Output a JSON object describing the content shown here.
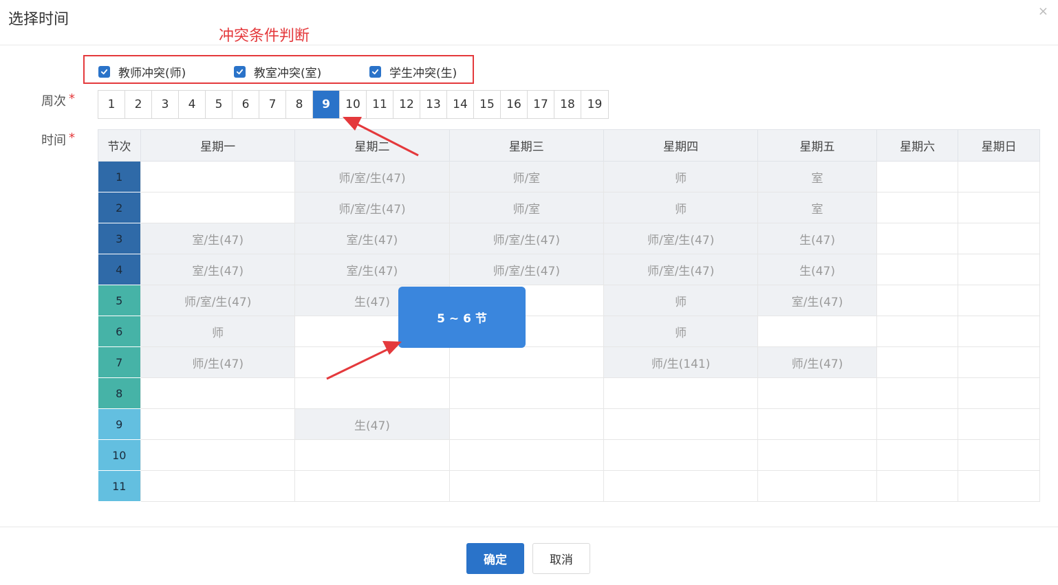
{
  "dialog": {
    "title": "选择时间",
    "close_symbol": "×"
  },
  "annotation": {
    "title": "冲突条件判断",
    "color": "#e4393c"
  },
  "conflicts": [
    {
      "label": "教师冲突(师)",
      "checked": true
    },
    {
      "label": "教室冲突(室)",
      "checked": true
    },
    {
      "label": "学生冲突(生)",
      "checked": true
    }
  ],
  "form": {
    "week_label": "周次",
    "time_label": "时间",
    "required_mark": "*"
  },
  "weeks": {
    "items": [
      "1",
      "2",
      "3",
      "4",
      "5",
      "6",
      "7",
      "8",
      "9",
      "10",
      "11",
      "12",
      "13",
      "14",
      "15",
      "16",
      "17",
      "18",
      "19"
    ],
    "selected": "9"
  },
  "timetable": {
    "period_header": "节次",
    "days": [
      "星期一",
      "星期二",
      "星期三",
      "星期四",
      "星期五",
      "星期六",
      "星期日"
    ],
    "periods": [
      {
        "label": "1",
        "color": "#2f6aa8"
      },
      {
        "label": "2",
        "color": "#2f6aa8"
      },
      {
        "label": "3",
        "color": "#2f6aa8"
      },
      {
        "label": "4",
        "color": "#2f6aa8"
      },
      {
        "label": "5",
        "color": "#46b3a7"
      },
      {
        "label": "6",
        "color": "#46b3a7"
      },
      {
        "label": "7",
        "color": "#46b3a7"
      },
      {
        "label": "8",
        "color": "#46b3a7"
      },
      {
        "label": "9",
        "color": "#63bfe0"
      },
      {
        "label": "10",
        "color": "#63bfe0"
      },
      {
        "label": "11",
        "color": "#63bfe0"
      }
    ],
    "cells": [
      [
        "",
        "师/室/生(47)",
        "师/室",
        "师",
        "室",
        "",
        ""
      ],
      [
        "",
        "师/室/生(47)",
        "师/室",
        "师",
        "室",
        "",
        ""
      ],
      [
        "室/生(47)",
        "室/生(47)",
        "师/室/生(47)",
        "师/室/生(47)",
        "生(47)",
        "",
        ""
      ],
      [
        "室/生(47)",
        "室/生(47)",
        "师/室/生(47)",
        "师/室/生(47)",
        "生(47)",
        "",
        ""
      ],
      [
        "师/室/生(47)",
        "生(47)",
        "",
        "师",
        "室/生(47)",
        "",
        ""
      ],
      [
        "师",
        "",
        "",
        "师",
        "",
        "",
        ""
      ],
      [
        "师/生(47)",
        "",
        "",
        "师/生(141)",
        "师/生(47)",
        "",
        ""
      ],
      [
        "",
        "",
        "",
        "",
        "",
        "",
        ""
      ],
      [
        "",
        "生(47)",
        "",
        "",
        "",
        "",
        ""
      ],
      [
        "",
        "",
        "",
        "",
        "",
        "",
        ""
      ],
      [
        "",
        "",
        "",
        "",
        "",
        "",
        ""
      ]
    ],
    "shaded": [
      [
        false,
        true,
        true,
        true,
        true,
        false,
        false
      ],
      [
        false,
        true,
        true,
        true,
        true,
        false,
        false
      ],
      [
        true,
        true,
        true,
        true,
        true,
        false,
        false
      ],
      [
        true,
        true,
        true,
        true,
        true,
        false,
        false
      ],
      [
        true,
        true,
        false,
        true,
        true,
        false,
        false
      ],
      [
        true,
        false,
        false,
        true,
        false,
        false,
        false
      ],
      [
        true,
        false,
        false,
        true,
        true,
        false,
        false
      ],
      [
        false,
        false,
        false,
        false,
        false,
        false,
        false
      ],
      [
        false,
        true,
        false,
        false,
        false,
        false,
        false
      ],
      [
        false,
        false,
        false,
        false,
        false,
        false,
        false
      ],
      [
        false,
        false,
        false,
        false,
        false,
        false,
        false
      ]
    ]
  },
  "selection": {
    "label": "5 ~ 6 节",
    "day": "星期三",
    "from_period": 5,
    "to_period": 6
  },
  "buttons": {
    "ok": "确定",
    "cancel": "取消"
  },
  "colors": {
    "primary": "#2a73c9",
    "selection": "#3a86dd",
    "shaded_cell": "#eff1f4",
    "arrow": "#e4393c"
  }
}
